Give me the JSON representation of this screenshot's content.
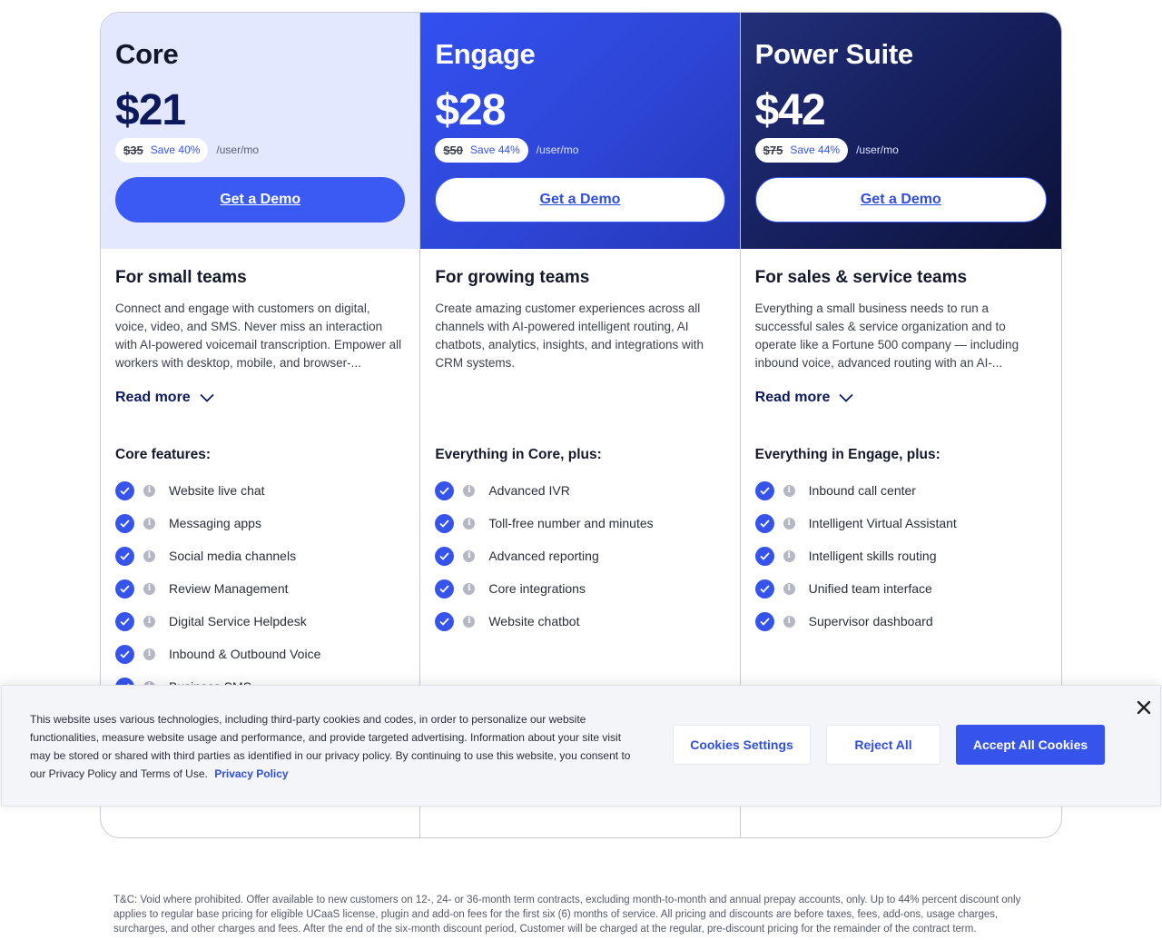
{
  "plans": [
    {
      "name": "Core",
      "price": "$21",
      "old_price": "$35",
      "save": "Save 40%",
      "per": "/user/mo",
      "cta": "Get a Demo",
      "tagline": "For small teams",
      "description": "Connect and engage with customers on digital, voice, video, and SMS. Never miss an interaction with AI-powered voicemail transcription. Empower all workers with desktop, mobile, and browser-...",
      "read_more": "Read more",
      "features_title": "Core features:",
      "features": [
        "Website live chat",
        "Messaging apps",
        "Social media channels",
        "Review Management",
        "Digital Service Helpdesk",
        "Inbound & Outbound Voice",
        "Business SMS"
      ]
    },
    {
      "name": "Engage",
      "price": "$28",
      "old_price": "$50",
      "save": "Save 44%",
      "per": "/user/mo",
      "cta": "Get a Demo",
      "tagline": "For growing teams",
      "description": "Create amazing customer experiences across all channels with AI-powered intelligent routing, AI chatbots, analytics, insights, and integrations with CRM systems.",
      "read_more": "",
      "features_title": "Everything in Core, plus:",
      "features": [
        "Advanced IVR",
        "Toll-free number and minutes",
        "Advanced reporting",
        "Core integrations",
        "Website chatbot"
      ]
    },
    {
      "name": "Power Suite",
      "price": "$42",
      "old_price": "$75",
      "save": "Save 44%",
      "per": "/user/mo",
      "cta": "Get a Demo",
      "tagline": "For sales & service teams",
      "description": "Everything a small business needs to run a successful sales & service organization and to operate like a Fortune 500 company — including inbound voice, advanced routing with an AI-...",
      "read_more": "Read more",
      "features_title": "Everything in Engage, plus:",
      "features": [
        "Inbound call center",
        "Intelligent Virtual Assistant",
        "Intelligent skills routing",
        "Unified team interface",
        "Supervisor dashboard"
      ]
    }
  ],
  "cookie_banner": {
    "text": "This website uses various technologies, including third-party cookies and codes, in order to personalize our website functionalities, measure website usage and performance, and provide targeted advertising. Information about your site visit may be stored or shared with third parties as identified in our privacy policy. By continuing to use this website, you consent to our Privacy Policy and Terms of Use.",
    "privacy_link": "Privacy Policy",
    "settings_label": "Cookies Settings",
    "reject_label": "Reject All",
    "accept_label": "Accept All Cookies"
  },
  "terms": "T&C: Void where prohibited. Offer available to new customers on 12-, 24- or 36-month term contracts, excluding month-to-month and annual prepay accounts, only. Up to 44% percent discount only applies to regular base pricing for eligible UCaaS license, plugin and add-on fees for the first six (6) months of service. All pricing and discounts are before taxes, fees, add-ons, usage charges, surcharges, and other charges and fees. After the end of the six-month discount period, Customer will be charged at the regular, pre-discount pricing for the remainder of the contract term.",
  "colors": {
    "accent": "#3654ec",
    "core_header": "#e4e8fe",
    "engage_header": "#3350f0",
    "power_header": "#172160"
  }
}
